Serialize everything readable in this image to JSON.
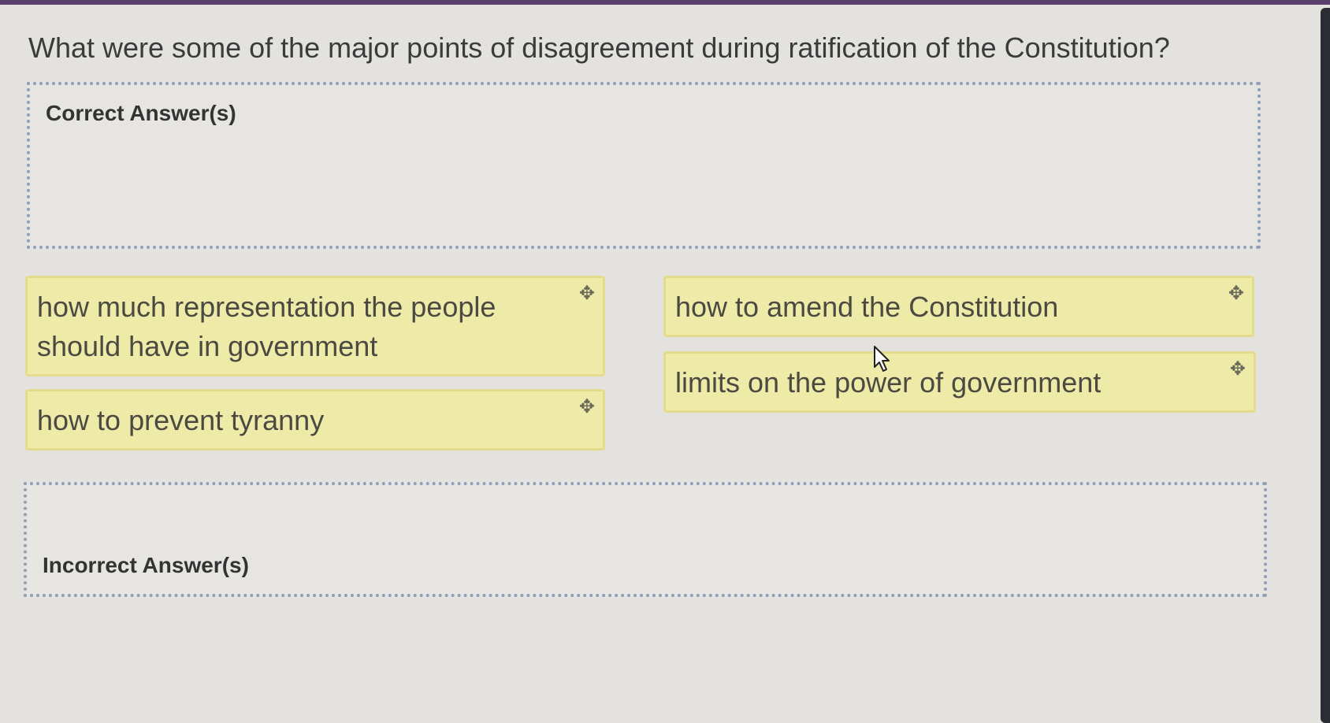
{
  "question": "What were some of the major points of disagreement during ratification of the Constitution?",
  "zones": {
    "correct_label": "Correct Answer(s)",
    "incorrect_label": "Incorrect Answer(s)"
  },
  "cards": [
    {
      "text": "how much representation the people should have in government"
    },
    {
      "text": "how to prevent tyranny"
    },
    {
      "text": "how to amend the Constitution"
    },
    {
      "text": "limits on the power of government"
    }
  ],
  "icons": {
    "drag_handle": "move-icon",
    "pointer": "cursor-icon"
  },
  "colors": {
    "card_bg": "#eeeba8",
    "card_border": "#e2dc8c",
    "zone_border": "#8f9fb6",
    "background": "#e3e2df"
  }
}
